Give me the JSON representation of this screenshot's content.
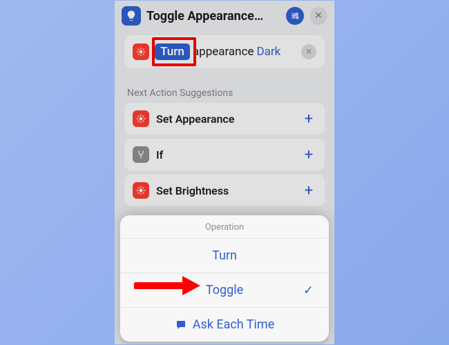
{
  "header": {
    "title": "Toggle Appearance…"
  },
  "action": {
    "token": "Turn",
    "word": "appearance",
    "param": "Dark"
  },
  "suggestions": {
    "label": "Next Action Suggestions",
    "items": [
      {
        "name": "Set Appearance"
      },
      {
        "name": "If"
      },
      {
        "name": "Set Brightness"
      }
    ]
  },
  "sheet": {
    "title": "Operation",
    "options": [
      {
        "label": "Turn",
        "checked": false
      },
      {
        "label": "Toggle",
        "checked": true
      }
    ],
    "ask": "Ask Each Time"
  }
}
